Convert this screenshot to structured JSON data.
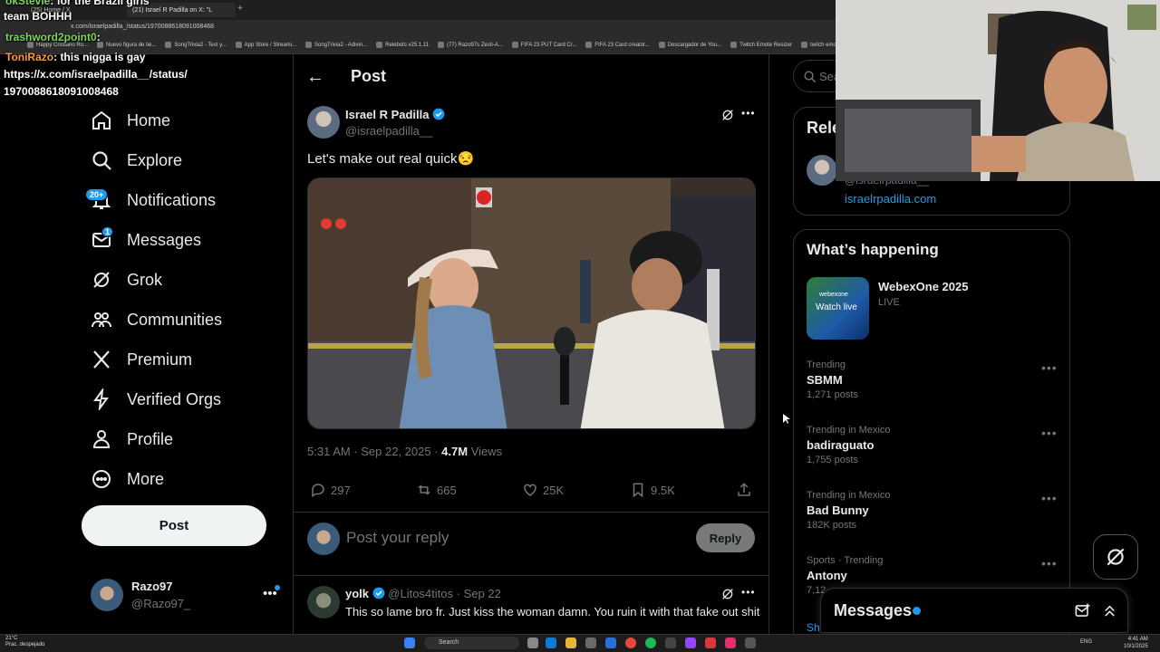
{
  "browser": {
    "tabs": [
      "(25) Home / X",
      "(21) Israel R Padilla on X: \"L"
    ],
    "url": "x.com/israelpadilla_/status/1970088618091008468",
    "bookmarks": [
      "Happy Cristiano Ro...",
      "Nuevo figura de tie...",
      "SongTrivia2 - Test y...",
      "App Store / Streami...",
      "SongTrivia2 - Adivin...",
      "Relebots v25.1.11",
      "(77) Razo97s Zesti-A...",
      "FIFA 23 PUT Card Cr...",
      "FIFA 23 Card creator...",
      "Descargador de You...",
      "Twitch Emote Resizer",
      "twitch emote resize..."
    ]
  },
  "chat": [
    {
      "user": "okStevie",
      "text": ": for the Brazil girls"
    },
    {
      "user": "",
      "text": "team BOHHH"
    },
    {
      "user": "trashword2point0",
      "text": ":"
    },
    {
      "user": "ToniRazo",
      "text": ": this nigga is gay"
    },
    {
      "user": "",
      "text": "https://x.com/israelpadilla__/status/"
    },
    {
      "user": "",
      "text": "1970088618091008468"
    }
  ],
  "sidebar": {
    "items": [
      {
        "label": "Home",
        "icon": "home-icon"
      },
      {
        "label": "Explore",
        "icon": "search-icon"
      },
      {
        "label": "Notifications",
        "icon": "bell-icon",
        "badge": "20+"
      },
      {
        "label": "Messages",
        "icon": "envelope-icon",
        "badge": "1"
      },
      {
        "label": "Grok",
        "icon": "grok-icon"
      },
      {
        "label": "Communities",
        "icon": "communities-icon"
      },
      {
        "label": "Premium",
        "icon": "x-logo-icon"
      },
      {
        "label": "Verified Orgs",
        "icon": "lightning-icon"
      },
      {
        "label": "Profile",
        "icon": "person-icon"
      },
      {
        "label": "More",
        "icon": "more-circle-icon"
      }
    ],
    "post_button": "Post",
    "account": {
      "name": "Razo97",
      "handle": "@Razo97_"
    }
  },
  "main": {
    "header_title": "Post",
    "tweet": {
      "author_name": "Israel R Padilla",
      "author_handle": "@israelpadilla__",
      "text": "Let's make out real quick😒",
      "time": "5:31 AM · Sep 22, 2025",
      "views_count": "4.7M",
      "views_label": "Views",
      "replies": "297",
      "reposts": "665",
      "likes": "25K",
      "bookmarks": "9.5K"
    },
    "reply_placeholder": "Post your reply",
    "reply_button": "Reply",
    "reply": {
      "author_name": "yolk",
      "author_handle": "@Litos4titos",
      "date": "Sep 22",
      "text": "This so lame bro fr. Just kiss the woman damn. You ruin it with that fake out shit"
    }
  },
  "right": {
    "search_placeholder": "Sea",
    "relevant_title": "Rele",
    "relevant_handle": "@israelrpadilla__",
    "relevant_link": "israelrpadilla.com",
    "happening_title": "What’s happening",
    "event": {
      "name": "WebexOne 2025",
      "status": "LIVE",
      "thumb_brand": "webexone",
      "thumb_text": "Watch live"
    },
    "trends": [
      {
        "label": "Trending",
        "name": "SBMM",
        "count": "1,271 posts"
      },
      {
        "label": "Trending in Mexico",
        "name": "badiraguato",
        "count": "1,755 posts"
      },
      {
        "label": "Trending in Mexico",
        "name": "Bad Bunny",
        "count": "182K posts"
      },
      {
        "label": "Sports · Trending",
        "name": "Antony",
        "count": "7,12"
      }
    ],
    "show_more": "Sh",
    "messages_title": "Messages"
  },
  "taskbar": {
    "weather_temp": "21°C",
    "weather_desc": "Prac. despejado",
    "search": "Search",
    "lang": "ENG",
    "time": "4:41 AM",
    "date": "10/1/2025"
  },
  "colors": {
    "accent": "#1d9bf0",
    "bg": "#000000",
    "border": "#2f3336"
  }
}
